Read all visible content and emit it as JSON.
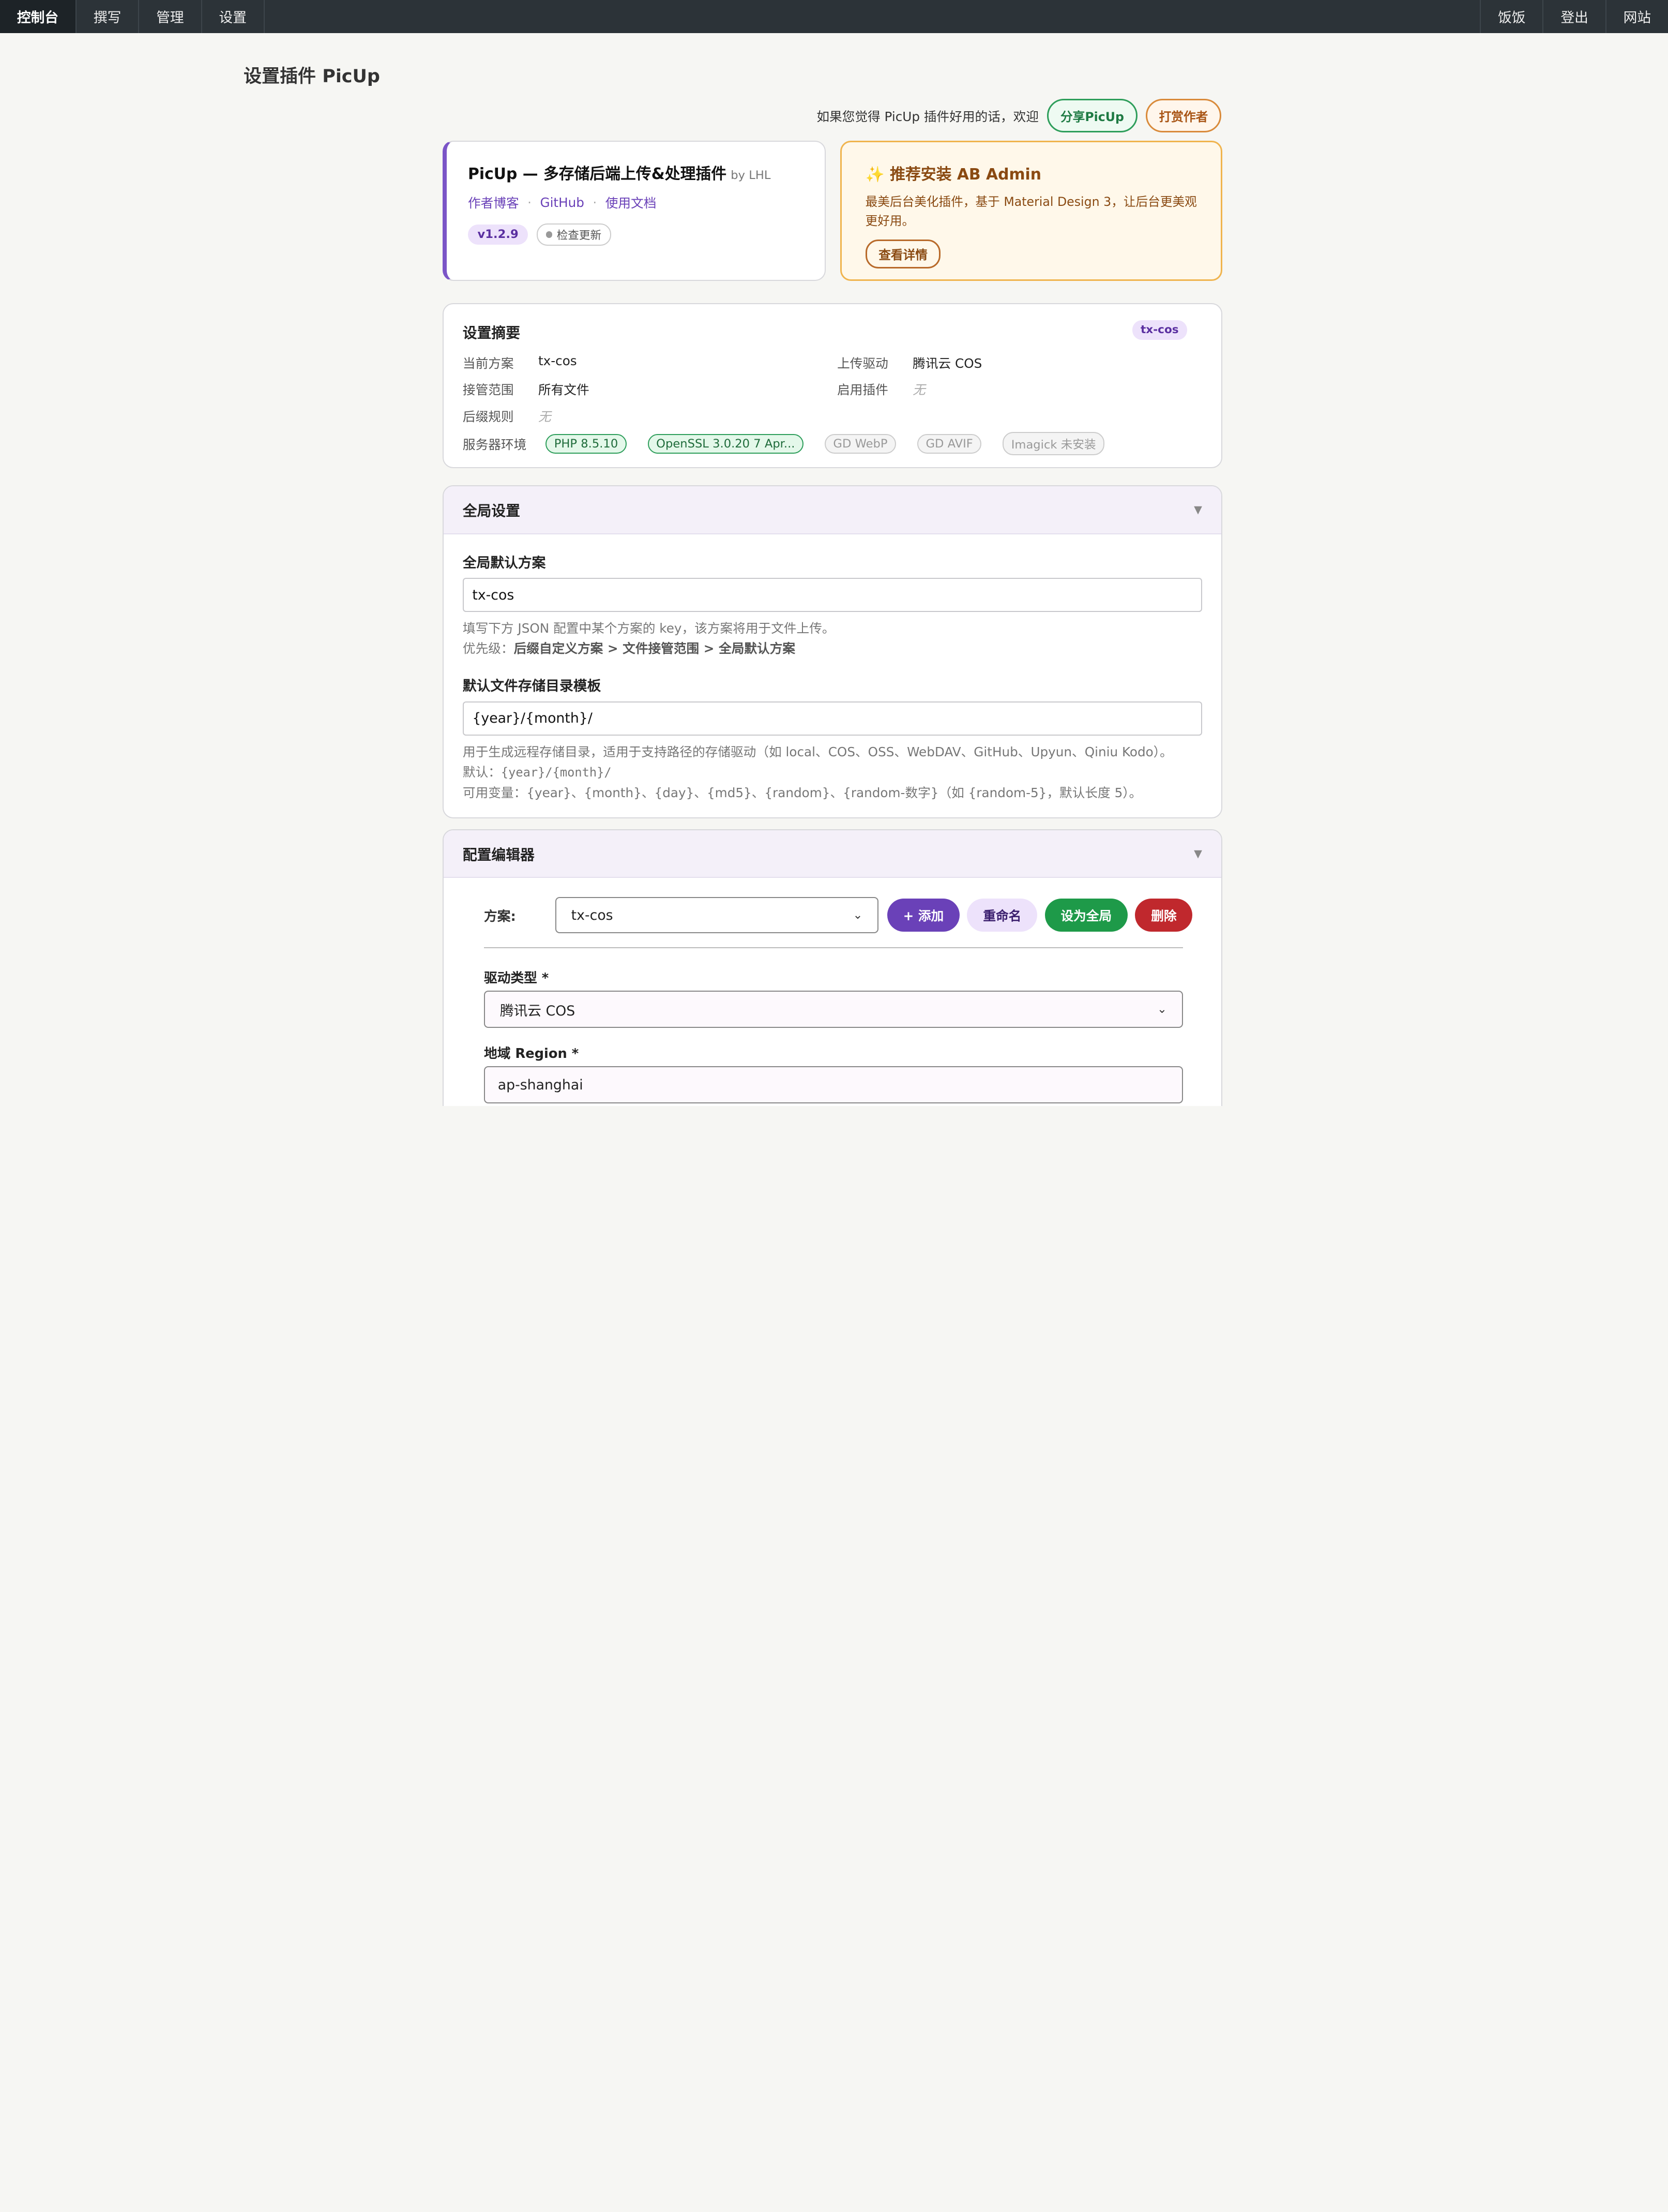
{
  "topnav": {
    "left": [
      "控制台",
      "撰写",
      "管理",
      "设置"
    ],
    "right": [
      "饭饭",
      "登出",
      "网站"
    ]
  },
  "page_title": "设置插件 PicUp",
  "promo": {
    "text": "如果您觉得 PicUp 插件好用的话，欢迎",
    "share_label": "分享PicUp",
    "donate_label": "打赏作者"
  },
  "plugin": {
    "name": "PicUp — 多存储后端上传&处理插件",
    "by": "by LHL",
    "links": [
      "作者博客",
      "GitHub",
      "使用文档"
    ],
    "version": "v1.2.9",
    "check_update": "检查更新"
  },
  "ab_promo": {
    "star": "✨",
    "title": "推荐安装 AB Admin",
    "desc": "最美后台美化插件，基于 Material Design 3，让后台更美观更好用。",
    "button": "查看详情"
  },
  "summary": {
    "title": "设置摘要",
    "tag": "tx-cos",
    "rows": {
      "scheme_k": "当前方案",
      "scheme_v": "tx-cos",
      "driver_k": "上传驱动",
      "driver_v": "腾讯云 COS",
      "scope_k": "接管范围",
      "scope_v": "所有文件",
      "plugins_k": "启用插件",
      "plugins_v": "无",
      "suffix_k": "后缀规则",
      "suffix_v": "无"
    },
    "env_label": "服务器环境",
    "envs": [
      "PHP 8.5.10",
      "OpenSSL 3.0.20 7 Apr...",
      "GD WebP",
      "GD AVIF",
      "Imagick 未安装"
    ]
  },
  "global_settings": {
    "title": "全局设置",
    "default_scheme_label": "全局默认方案",
    "default_scheme_value": "tx-cos",
    "default_scheme_help1": "填写下方 JSON 配置中某个方案的 key，该方案将用于文件上传。",
    "default_scheme_help2_prefix": "优先级：",
    "default_scheme_help2_bold": "后缀自定义方案 > 文件接管范围 > 全局默认方案",
    "dir_label": "默认文件存储目录模板",
    "dir_value": "{year}/{month}/",
    "dir_help1": "用于生成远程存储目录，适用于支持路径的存储驱动（如 local、COS、OSS、WebDAV、GitHub、Upyun、Qiniu Kodo）。",
    "dir_help2_prefix": "默认：",
    "dir_help2_code": "{year}/{month}/",
    "dir_help3": "可用变量：{year}、{month}、{day}、{md5}、{random}、{random-数字}（如 {random-5}，默认长度 5）。"
  },
  "editor": {
    "title": "配置编辑器",
    "scheme_label": "方案:",
    "scheme_value": "tx-cos",
    "buttons": {
      "add": "+ 添加",
      "rename": "重命名",
      "set_global": "设为全局",
      "delete": "删除"
    },
    "driver_label": "驱动类型 *",
    "driver_value": "腾讯云 COS",
    "region_label": "地域 Region *",
    "region_value": "ap-shanghai"
  },
  "colors": {
    "topbar": "#2c3338",
    "accent_purple": "#6a41b8",
    "green": "#1e9a49",
    "red": "#c0282d",
    "orange": "#f0b44e"
  }
}
